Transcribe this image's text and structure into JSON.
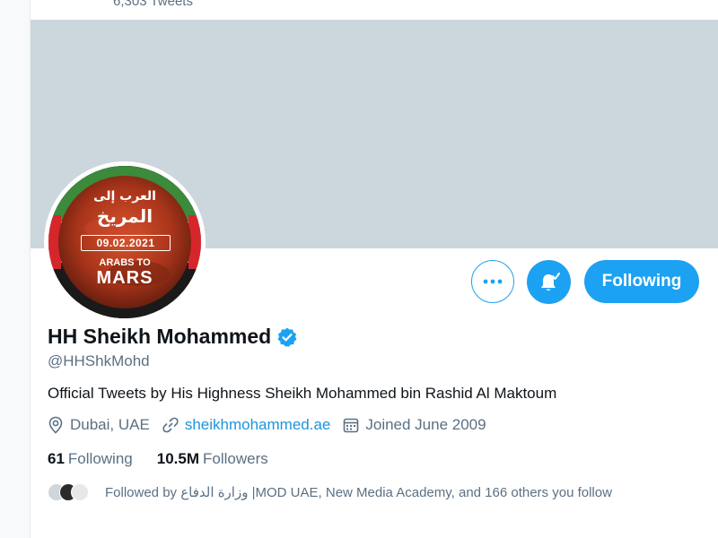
{
  "header": {
    "tweet_count": "6,303 Tweets"
  },
  "avatar": {
    "arabic_line1": "العرب إلى",
    "arabic_line2": "المريخ",
    "date": "09.02.2021",
    "arabs_to": "ARABS TO",
    "mars": "MARS"
  },
  "actions": {
    "more_icon": "more-horizontal-icon",
    "bell_icon": "notification-bell-icon",
    "following_label": "Following"
  },
  "profile": {
    "name": "HH Sheikh Mohammed",
    "verified_icon": "verified-badge-icon",
    "handle": "@HHShkMohd",
    "bio": "Official Tweets by His Highness Sheikh Mohammed bin Rashid Al Maktoum",
    "location": "Dubai, UAE",
    "website": "sheikhmohammed.ae",
    "joined": "Joined June 2009"
  },
  "stats": {
    "following_count": "61",
    "following_label": "Following",
    "followers_count": "10.5M",
    "followers_label": "Followers"
  },
  "followed_by": "Followed by وزارة الدفاع |MOD UAE, New Media Academy, and 166 others you follow",
  "colors": {
    "accent": "#1da1f2",
    "link": "#1b95e0",
    "muted": "#5b7083",
    "banner": "#ccd6dd"
  }
}
